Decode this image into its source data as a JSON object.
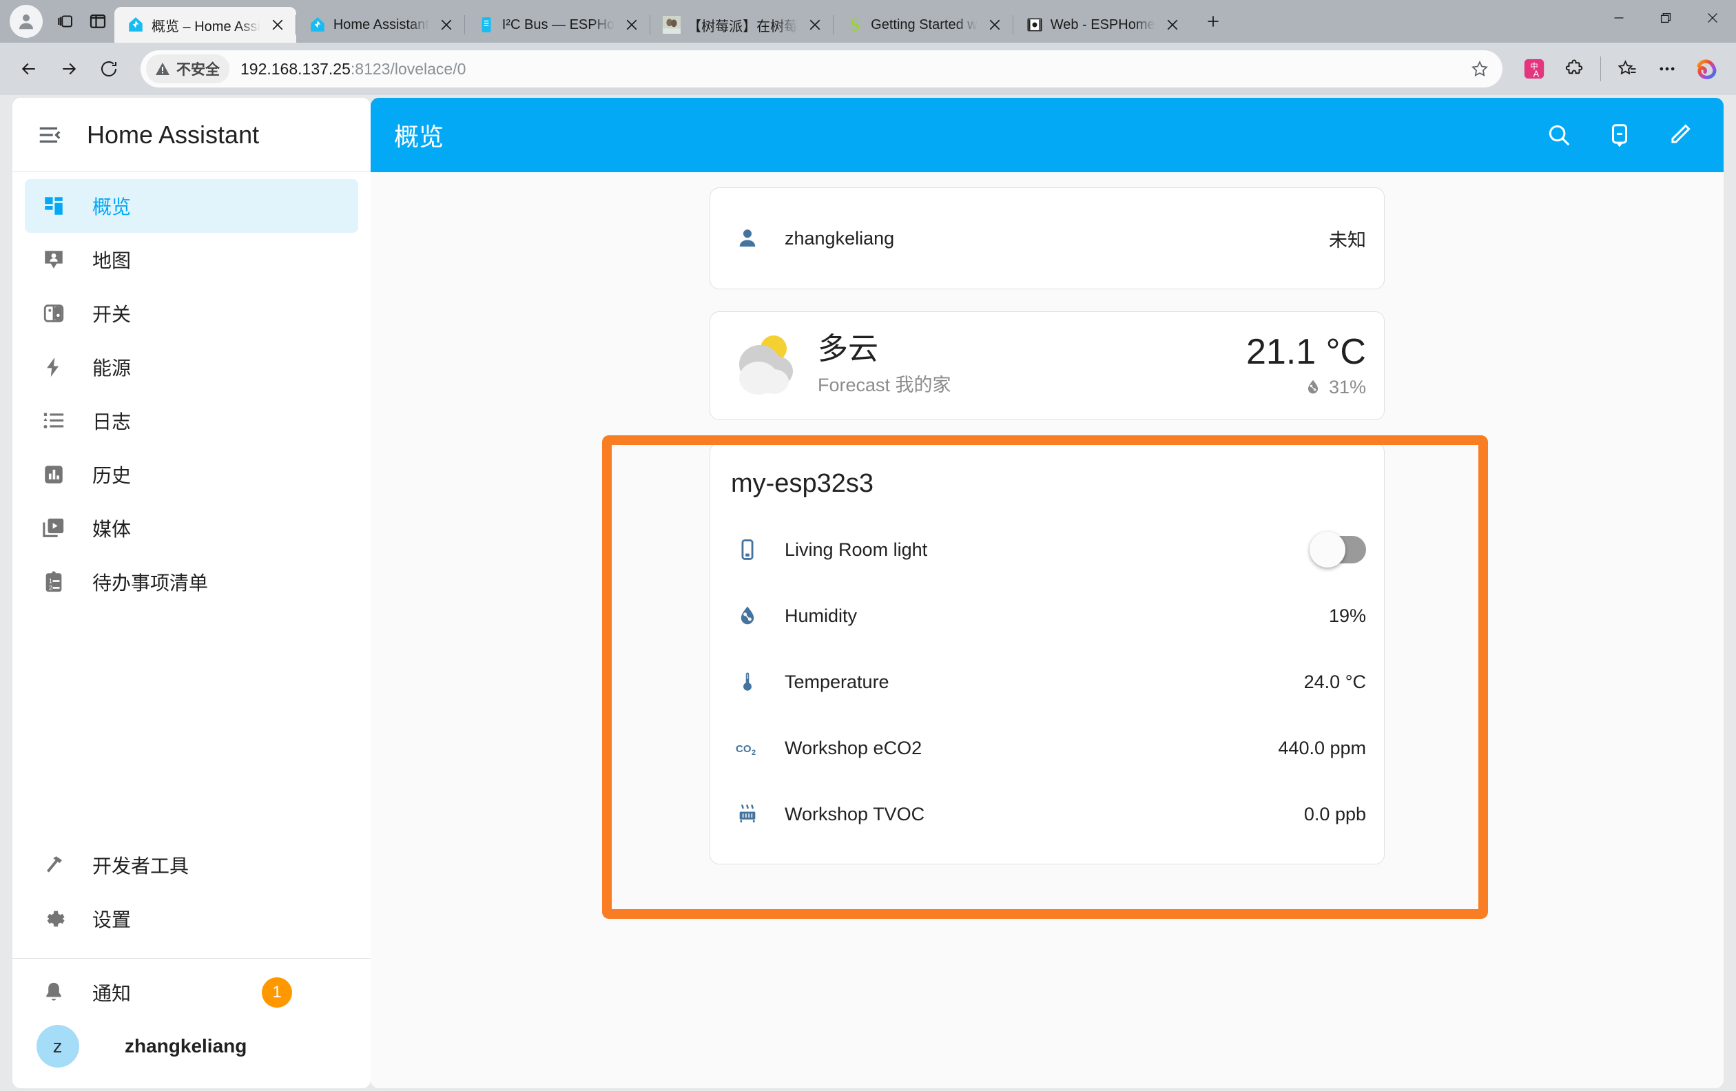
{
  "browser": {
    "profile_icon": "profile-avatar-icon",
    "workspaces_icon": "tab-groups-icon",
    "split_icon": "split-screen-icon",
    "new_tab_label": "+",
    "tabs": [
      {
        "title": "概览 – Home Assi",
        "favicon": "home-assistant-icon",
        "active": true
      },
      {
        "title": "Home Assistant",
        "favicon": "home-assistant-icon",
        "active": false
      },
      {
        "title": "I²C Bus — ESPHo",
        "favicon": "esphome-icon",
        "active": false
      },
      {
        "title": "【树莓派】在树莓",
        "favicon": "image-thumbnail-icon",
        "active": false
      },
      {
        "title": "Getting Started w",
        "favicon": "sparkfun-s-icon",
        "active": false
      },
      {
        "title": "Web - ESPHome",
        "favicon": "web-serial-icon",
        "active": false
      }
    ],
    "window_controls": {
      "minimize": "minimize-icon",
      "restore": "restore-icon",
      "close": "close-icon"
    },
    "toolbar": {
      "back": "back-arrow-icon",
      "forward": "forward-arrow-icon",
      "reload": "reload-icon",
      "security_label": "不安全",
      "url_host": "192.168.137.25",
      "url_rest": ":8123/lovelace/0",
      "favorite": "star-outline-icon",
      "translate": "translate-icon",
      "extensions": "extensions-puzzle-icon",
      "collections": "collections-icon",
      "settings_more": "more-ellipsis-icon",
      "copilot": "copilot-icon"
    }
  },
  "sidebar": {
    "menu_icon": "menu-collapse-icon",
    "title": "Home Assistant",
    "items": [
      {
        "label": "概览",
        "icon": "view-dashboard-icon",
        "active": true
      },
      {
        "label": "地图",
        "icon": "map-marker-account-icon",
        "active": false
      },
      {
        "label": "开关",
        "icon": "toggle-switch-icon",
        "active": false
      },
      {
        "label": "能源",
        "icon": "lightning-bolt-icon",
        "active": false
      },
      {
        "label": "日志",
        "icon": "format-list-icon",
        "active": false
      },
      {
        "label": "历史",
        "icon": "chart-box-icon",
        "active": false
      },
      {
        "label": "媒体",
        "icon": "play-box-multiple-icon",
        "active": false
      },
      {
        "label": "待办事项清单",
        "icon": "clipboard-list-icon",
        "active": false
      }
    ],
    "tools": [
      {
        "label": "开发者工具",
        "icon": "hammer-icon"
      },
      {
        "label": "设置",
        "icon": "cog-icon"
      }
    ],
    "notifications": {
      "label": "通知",
      "icon": "bell-icon",
      "badge": "1"
    },
    "user": {
      "label": "zhangkeliang",
      "initial": "z"
    }
  },
  "appbar": {
    "title": "概览",
    "search_icon": "search-icon",
    "assist_icon": "assist-chat-icon",
    "edit_icon": "pencil-edit-icon"
  },
  "cards": {
    "person": {
      "icon": "account-icon",
      "name": "zhangkeliang",
      "state": "未知"
    },
    "weather": {
      "icon": "partly-cloudy-icon",
      "state": "多云",
      "subtitle": "Forecast 我的家",
      "temperature": "21.1 °C",
      "humidity_icon": "water-percent-icon",
      "humidity": "31%"
    },
    "entities": {
      "title": "my-esp32s3",
      "rows": [
        {
          "icon": "tablet-light-icon",
          "name": "Living Room light",
          "value": "",
          "control": "toggle",
          "toggle_on": false
        },
        {
          "icon": "water-percent-icon",
          "name": "Humidity",
          "value": "19%",
          "control": "text"
        },
        {
          "icon": "thermometer-icon",
          "name": "Temperature",
          "value": "24.0 °C",
          "control": "text"
        },
        {
          "icon": "molecule-co2-icon",
          "name": "Workshop eCO2",
          "value": "440.0 ppm",
          "control": "text"
        },
        {
          "icon": "radiator-icon",
          "name": "Workshop TVOC",
          "value": "0.0 ppb",
          "control": "text"
        }
      ]
    }
  },
  "annotation": {
    "color": "#f97d22",
    "target": "my-esp32s3 entities card"
  }
}
